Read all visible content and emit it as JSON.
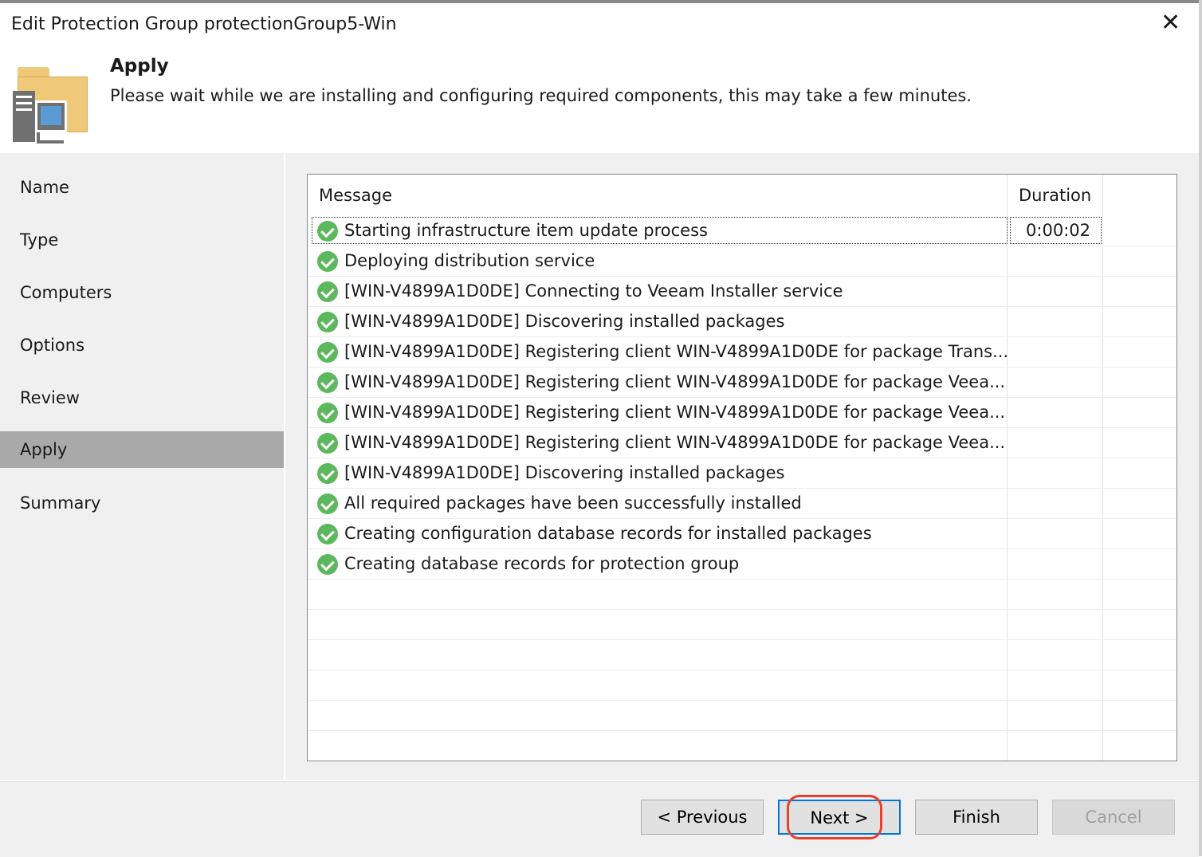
{
  "window": {
    "title": "Edit Protection Group protectionGroup5-Win",
    "close_icon": "close-icon"
  },
  "header": {
    "icon": "folder-computer-icon",
    "step_title": "Apply",
    "description": "Please wait while we are installing and configuring required components, this may take a few minutes."
  },
  "nav": {
    "items": [
      {
        "label": "Name"
      },
      {
        "label": "Type"
      },
      {
        "label": "Computers"
      },
      {
        "label": "Options"
      },
      {
        "label": "Review"
      },
      {
        "label": "Apply",
        "active": true
      },
      {
        "label": "Summary"
      }
    ]
  },
  "table": {
    "columns": [
      "Message",
      "Duration"
    ],
    "status_icon": "success-check-icon",
    "status_color": "#5cb85c",
    "rows": [
      {
        "message": "Starting infrastructure item update process",
        "duration": "0:00:02"
      },
      {
        "message": "Deploying distribution service",
        "duration": ""
      },
      {
        "message": "[WIN-V4899A1D0DE] Connecting to Veeam Installer service",
        "duration": ""
      },
      {
        "message": "[WIN-V4899A1D0DE] Discovering installed packages",
        "duration": ""
      },
      {
        "message": "[WIN-V4899A1D0DE] Registering client WIN-V4899A1D0DE for package Trans...",
        "duration": ""
      },
      {
        "message": "[WIN-V4899A1D0DE] Registering client WIN-V4899A1D0DE for package Veea...",
        "duration": ""
      },
      {
        "message": "[WIN-V4899A1D0DE] Registering client WIN-V4899A1D0DE for package Veea...",
        "duration": ""
      },
      {
        "message": "[WIN-V4899A1D0DE] Registering client WIN-V4899A1D0DE for package Veea...",
        "duration": ""
      },
      {
        "message": "[WIN-V4899A1D0DE] Discovering installed packages",
        "duration": ""
      },
      {
        "message": "All required packages have been successfully installed",
        "duration": ""
      },
      {
        "message": "Creating configuration database records for installed packages",
        "duration": ""
      },
      {
        "message": "Creating database records for protection group",
        "duration": ""
      }
    ]
  },
  "footer": {
    "previous_label": "< Previous",
    "next_label": "Next >",
    "finish_label": "Finish",
    "cancel_label": "Cancel",
    "highlight_color": "#e8402a",
    "focus_color": "#0078d7"
  }
}
